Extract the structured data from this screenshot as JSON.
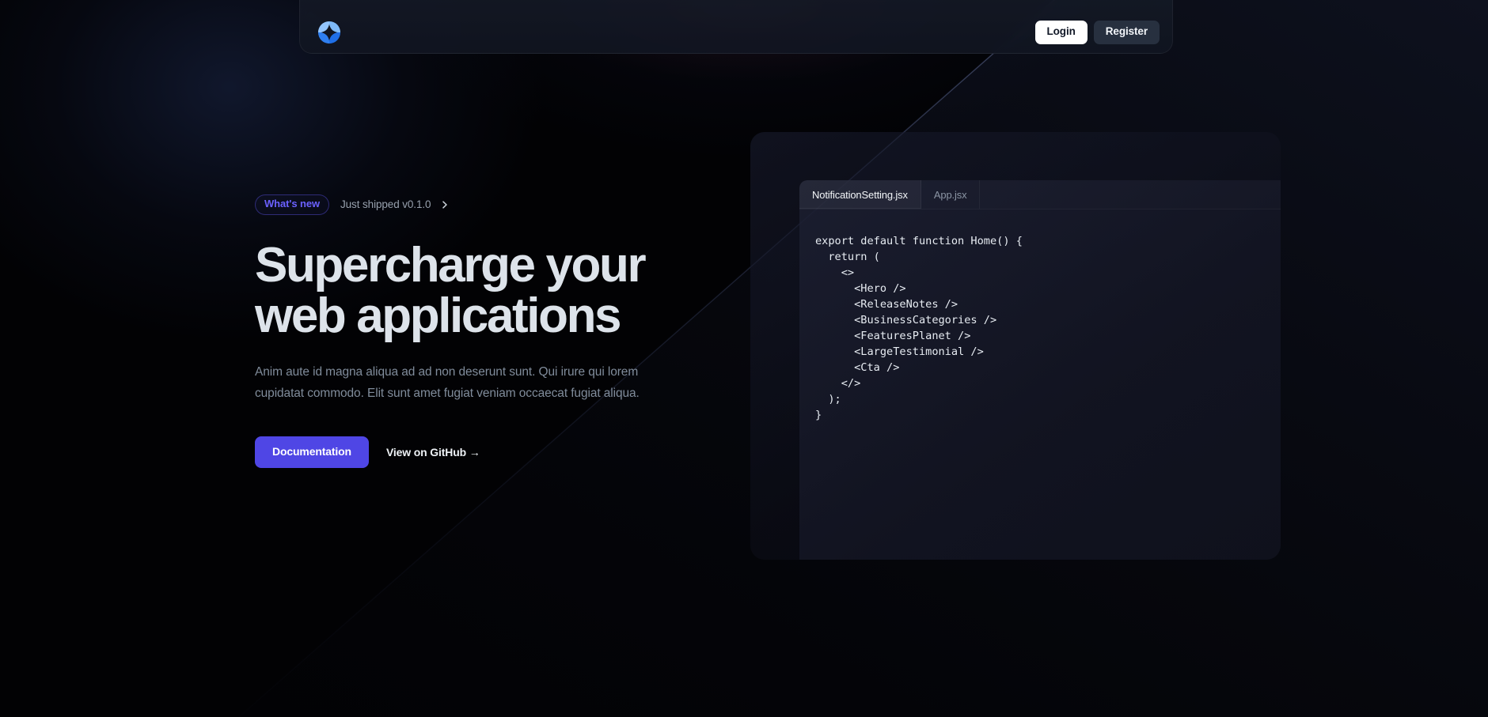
{
  "colors": {
    "page_background": "#020204",
    "accent_indigo": "#4f46e5",
    "pill_indigo": "#6b61ff",
    "logo_blue_light": "#93c5fd",
    "logo_blue": "#2563eb",
    "heading": "#dde3ea",
    "body_text": "#808c9b",
    "login_button_bg": "#ffffff",
    "login_button_text": "#111827",
    "register_button_bg": "#27303f",
    "register_button_text": "#f2f5f9"
  },
  "navbar": {
    "logo_icon": "four-petal-circle-logo",
    "login_label": "Login",
    "register_label": "Register"
  },
  "hero": {
    "badge_label": "What's new",
    "badge_note": "Just shipped v0.1.0",
    "badge_chevron_icon": "chevron-right-icon",
    "title": "Supercharge your web applications",
    "subtitle": "Anim aute id magna aliqua ad ad non deserunt sunt. Qui irure qui lorem cupidatat commodo. Elit sunt amet fugiat veniam occaecat fugiat aliqua.",
    "primary_cta": "Documentation",
    "secondary_cta": "View on GitHub →"
  },
  "code_panel": {
    "tabs": [
      {
        "label": "NotificationSetting.jsx",
        "active": true
      },
      {
        "label": "App.jsx",
        "active": false
      }
    ],
    "code": "export default function Home() {\n  return (\n    <>\n      <Hero />\n      <ReleaseNotes />\n      <BusinessCategories />\n      <FeaturesPlanet />\n      <LargeTestimonial />\n      <Cta />\n    </>\n  );\n}"
  }
}
